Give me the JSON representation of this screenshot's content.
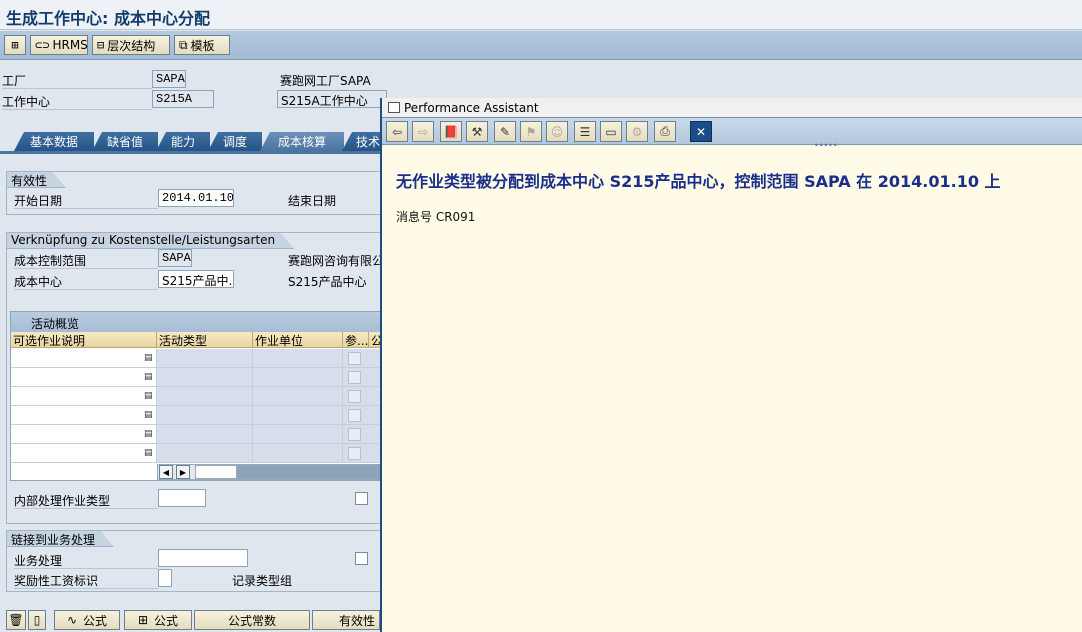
{
  "window": {
    "title": "生成工作中心: 成本中心分配"
  },
  "toolbar": {
    "hrms_label": "HRMS",
    "hierarchy_label": "层次结构",
    "template_label": "模板"
  },
  "header": {
    "plant_label": "工厂",
    "plant_value": "SAPA",
    "plant_desc": "赛跑网工厂SAPA",
    "workcenter_label": "工作中心",
    "workcenter_value": "S215A",
    "workcenter_desc": "S215A工作中心"
  },
  "tabs": [
    {
      "label": "基本数据"
    },
    {
      "label": "缺省值"
    },
    {
      "label": "能力"
    },
    {
      "label": "调度"
    },
    {
      "label": "成本核算"
    },
    {
      "label": "技术"
    }
  ],
  "validity": {
    "title": "有效性",
    "start_label": "开始日期",
    "start_value": "2014.01.10",
    "end_label": "结束日期"
  },
  "assignment": {
    "title": "Verknüpfung zu Kostenstelle/Leistungsarten",
    "controlling_area_label": "成本控制范围",
    "controlling_area_value": "SAPA",
    "controlling_area_desc": "赛跑网咨询有限公",
    "cost_center_label": "成本中心",
    "cost_center_value": "S215产品中.",
    "cost_center_desc": "S215产品中心"
  },
  "activity_table": {
    "caption": "活动概览",
    "columns": [
      "可选作业说明",
      "活动类型",
      "作业单位",
      "参...",
      "公"
    ],
    "rows": 6
  },
  "internal": {
    "label": "内部处理作业类型"
  },
  "link": {
    "title": "链接到业务处理",
    "process_label": "业务处理",
    "incentive_label": "奖励性工资标识",
    "record_type_label": "记录类型组"
  },
  "bottom_bar": {
    "formula1_label": "公式",
    "formula2_label": "公式",
    "formula_const_label": "公式常数",
    "validity_label": "有效性"
  },
  "performance_assistant": {
    "title": "Performance Assistant",
    "message": "无作业类型被分配到成本中心  S215产品中心，控制范围  SAPA 在  2014.01.10 上",
    "message_no": "消息号  CR091",
    "close_icon": "close-icon"
  }
}
